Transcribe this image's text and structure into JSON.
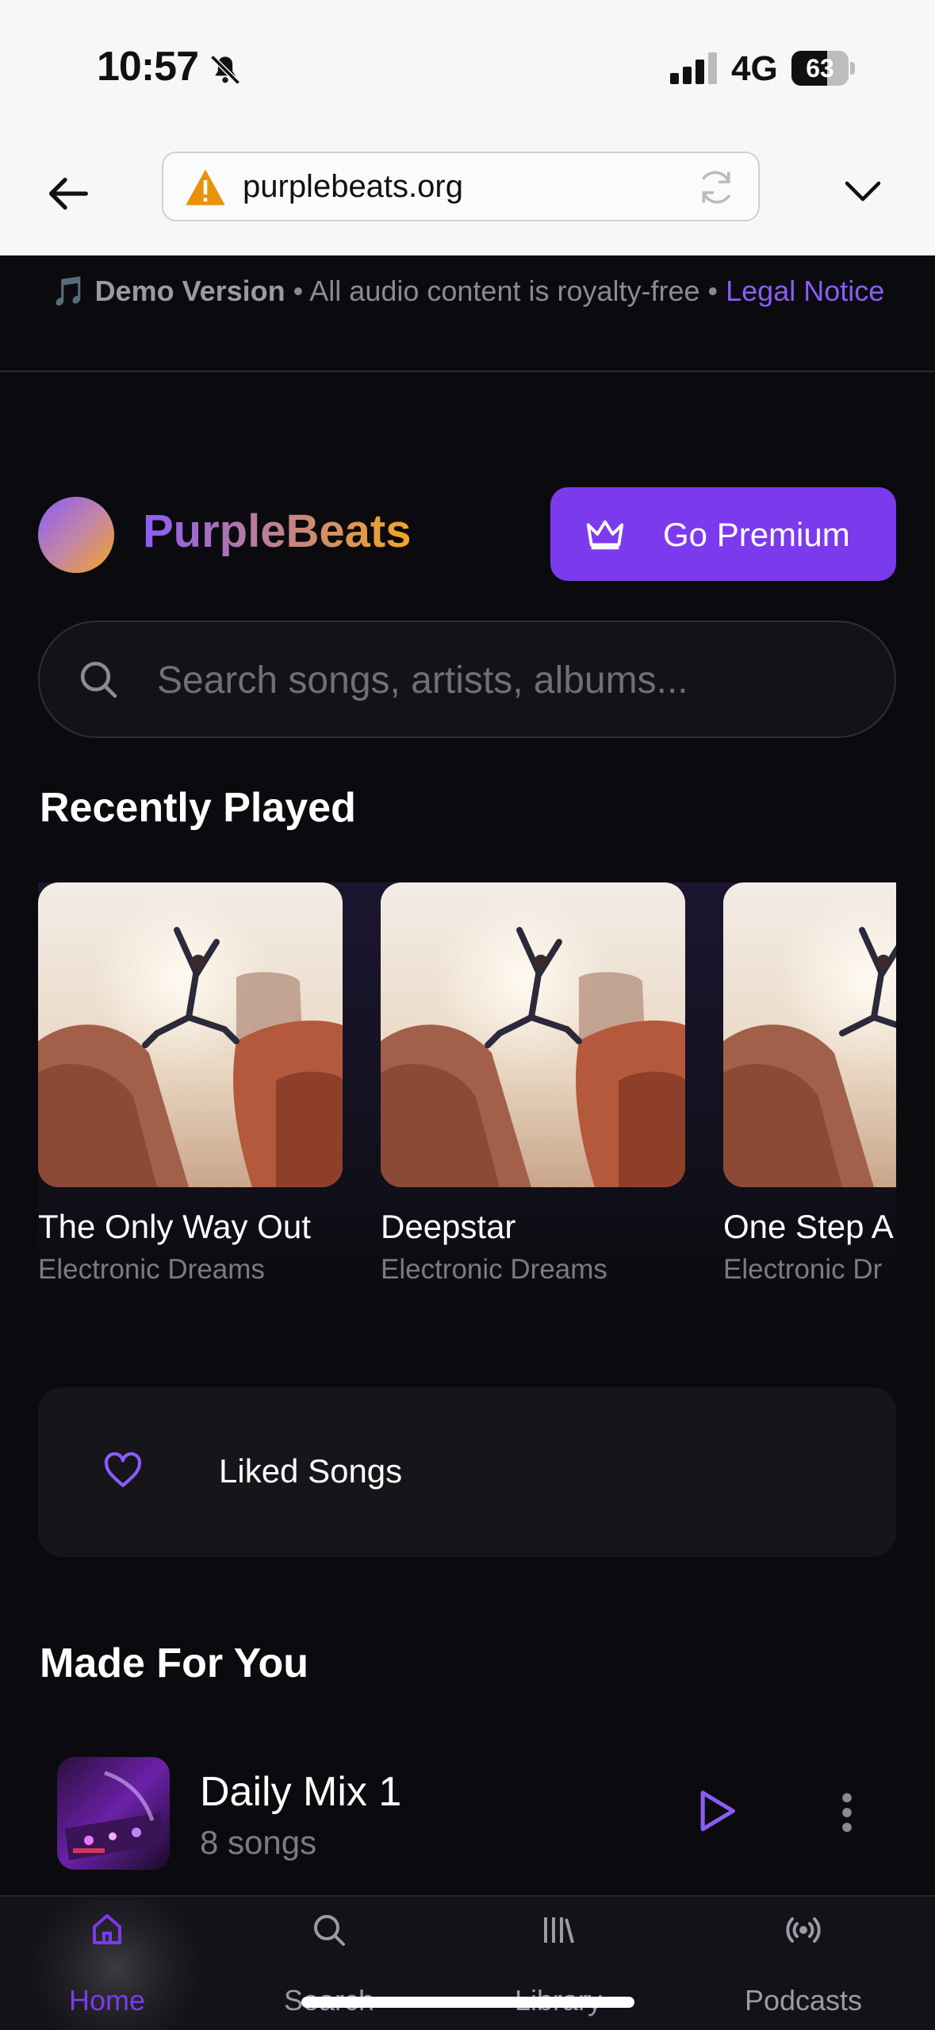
{
  "status_bar": {
    "time": "10:57",
    "network": "4G",
    "battery": "63",
    "battery_level": 0.63
  },
  "browser": {
    "url": "purplebeats.org"
  },
  "banner": {
    "emoji": "🎵",
    "demo_label": "Demo Version",
    "separator": " • ",
    "notice": "All audio content is royalty-free",
    "legal_link": "Legal Notice"
  },
  "header": {
    "brand": "PurpleBeats",
    "premium_button": "Go Premium"
  },
  "search": {
    "placeholder": "Search songs, artists, albums..."
  },
  "recently_played": {
    "title": "Recently Played",
    "items": [
      {
        "title": "The Only Way Out",
        "artist": "Electronic Dreams"
      },
      {
        "title": "Deepstar",
        "artist": "Electronic Dreams"
      },
      {
        "title": "One Step A",
        "artist": "Electronic Dr"
      }
    ]
  },
  "liked": {
    "label": "Liked Songs"
  },
  "made_for_you": {
    "title": "Made For You",
    "items": [
      {
        "title": "Daily Mix 1",
        "subtitle": "8 songs"
      }
    ]
  },
  "bottom_nav": {
    "items": [
      {
        "label": "Home",
        "icon": "home-icon",
        "active": true
      },
      {
        "label": "Search",
        "icon": "search-icon",
        "active": false
      },
      {
        "label": "Library",
        "icon": "library-icon",
        "active": false
      },
      {
        "label": "Podcasts",
        "icon": "podcast-icon",
        "active": false
      }
    ]
  },
  "colors": {
    "accent": "#7c3aed",
    "background": "#0b0b0f",
    "brand_gradient_end": "#f5a623"
  }
}
